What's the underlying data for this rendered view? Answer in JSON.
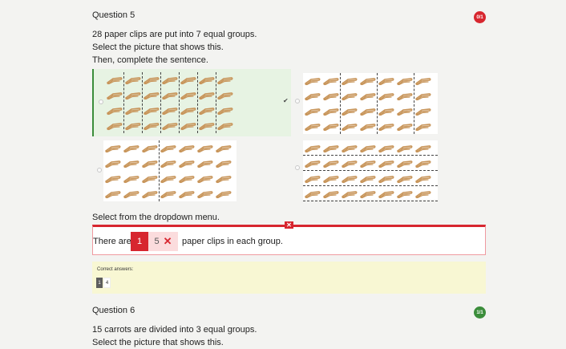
{
  "q5": {
    "title": "Question 5",
    "score": "0/1",
    "prompt_line1": "28 paper clips are put into 7 equal groups.",
    "prompt_line2": "Select the picture that shows this.",
    "prompt_line3": "Then, complete the sentence.",
    "options": [
      {
        "id": "A",
        "selected": true,
        "checked": true,
        "grouping": "7 columns"
      },
      {
        "id": "B",
        "selected": false,
        "checked": false,
        "grouping": "3 columns"
      },
      {
        "id": "C",
        "selected": false,
        "checked": false,
        "grouping": "2 columns"
      },
      {
        "id": "D",
        "selected": false,
        "checked": false,
        "grouping": "4 rows"
      }
    ],
    "dropdown_instruction": "Select from the dropdown menu.",
    "sentence_before": "There are",
    "selected_answer": "1",
    "wrong_value": "5",
    "sentence_after": "paper clips in each group.",
    "correct_label": "Correct answers:",
    "correct_values": [
      "1",
      "4"
    ]
  },
  "q6": {
    "title": "Question 6",
    "score": "1/1",
    "prompt_line1": "15 carrots are divided into 3 equal groups.",
    "prompt_line2": "Select the picture that shows this."
  },
  "colors": {
    "wrong": "#d7262f",
    "right": "#3b8d3b",
    "selected_bg": "#e7f3e3",
    "correct_bg": "#f8f7d3",
    "clip": "#c8955a"
  },
  "icons": [
    "paper-clip-icon",
    "check-icon",
    "close-icon",
    "radio-icon"
  ]
}
